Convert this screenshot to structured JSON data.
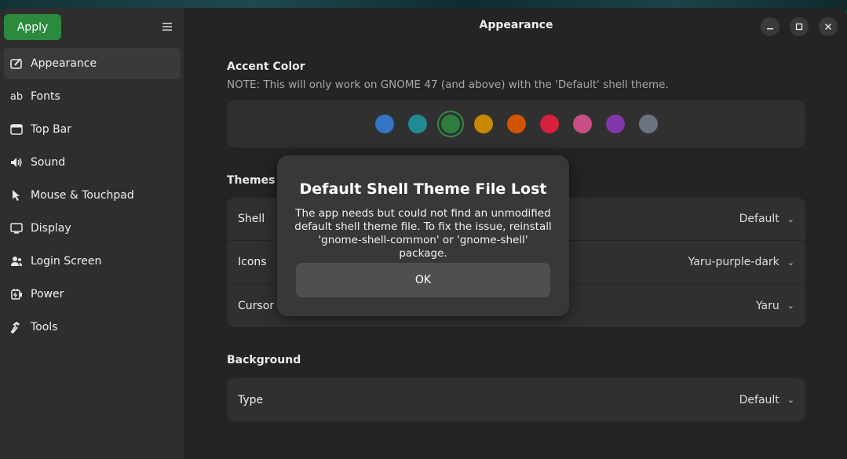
{
  "window": {
    "title": "Appearance"
  },
  "sidebar": {
    "apply_label": "Apply",
    "items": [
      {
        "label": "Appearance",
        "icon": "appearance-icon",
        "active": true
      },
      {
        "label": "Fonts",
        "icon": "fonts-icon"
      },
      {
        "label": "Top Bar",
        "icon": "top-bar-icon"
      },
      {
        "label": "Sound",
        "icon": "sound-icon"
      },
      {
        "label": "Mouse & Touchpad",
        "icon": "pointer-icon"
      },
      {
        "label": "Display",
        "icon": "display-icon"
      },
      {
        "label": "Login Screen",
        "icon": "users-icon"
      },
      {
        "label": "Power",
        "icon": "power-icon"
      },
      {
        "label": "Tools",
        "icon": "hammer-icon"
      }
    ]
  },
  "accent": {
    "title": "Accent Color",
    "note": "NOTE: This will only work on GNOME 47 (and above) with the 'Default' shell theme.",
    "colors": [
      "#3474c6",
      "#208a95",
      "#2f7d3e",
      "#c88800",
      "#d35400",
      "#d8203a",
      "#c84f86",
      "#8037a8",
      "#6a7480"
    ],
    "selected_index": 2
  },
  "themes": {
    "title": "Themes",
    "rows": [
      {
        "label": "Shell",
        "value": "Default"
      },
      {
        "label": "Icons",
        "value": "Yaru-purple-dark"
      },
      {
        "label": "Cursor",
        "value": "Yaru"
      }
    ]
  },
  "background": {
    "title": "Background",
    "rows": [
      {
        "label": "Type",
        "value": "Default"
      }
    ]
  },
  "dialog": {
    "title": "Default Shell Theme File Lost",
    "body": "The app needs but could not find an unmodified default shell theme file. To fix the issue, reinstall 'gnome-shell-common' or 'gnome-shell' package.",
    "ok_label": "OK"
  }
}
